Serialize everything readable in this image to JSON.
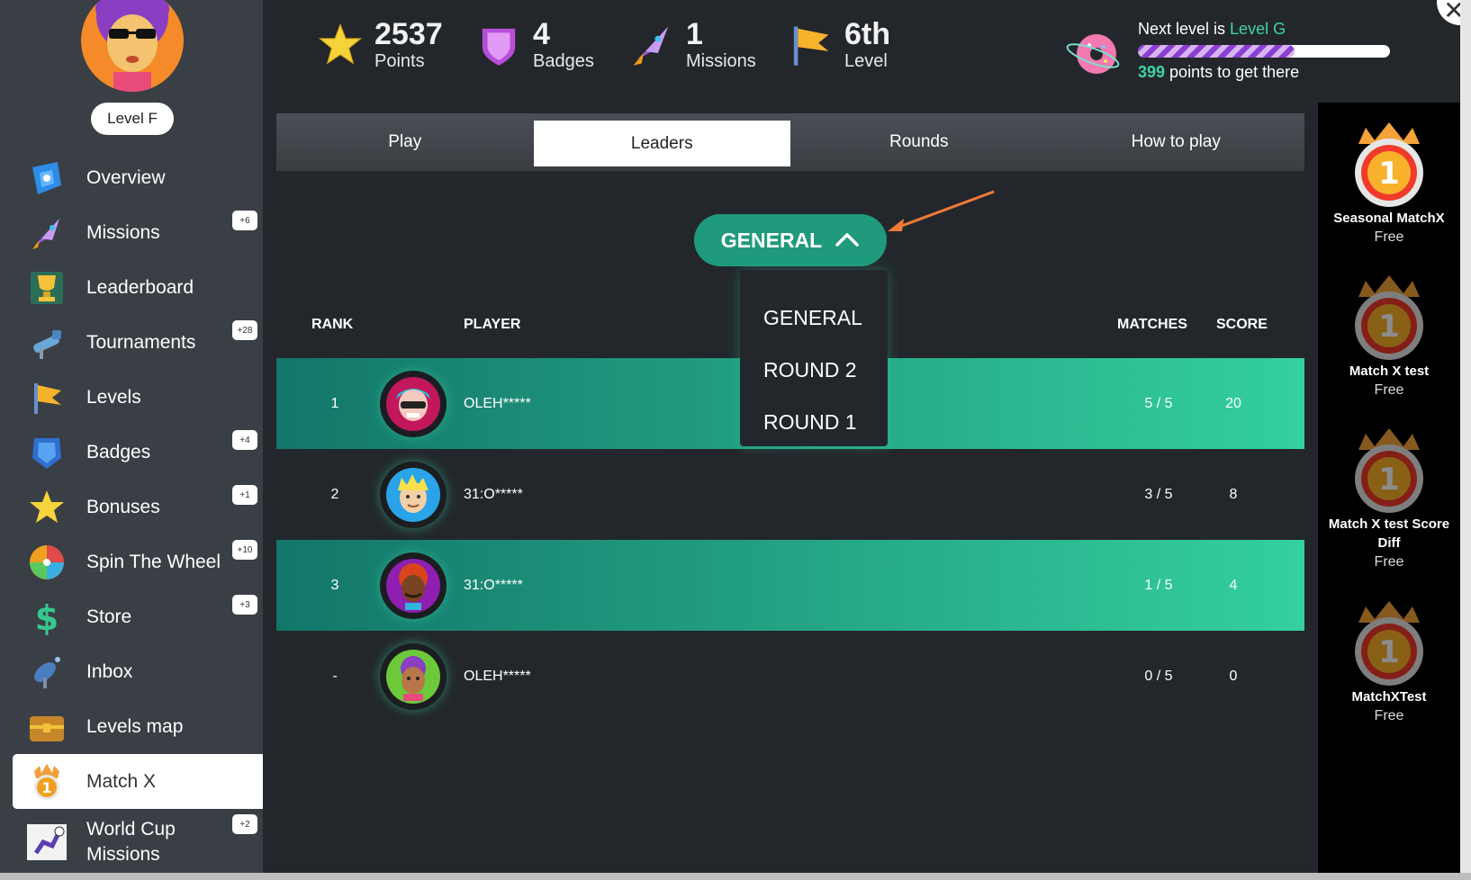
{
  "profile": {
    "level_label": "Level F"
  },
  "sidebar": {
    "items": [
      {
        "label": "Overview",
        "icon": "overview-icon"
      },
      {
        "label": "Missions",
        "icon": "rocket-icon",
        "badge": "+6"
      },
      {
        "label": "Leaderboard",
        "icon": "trophy-icon"
      },
      {
        "label": "Tournaments",
        "icon": "telescope-icon",
        "badge": "+28"
      },
      {
        "label": "Levels",
        "icon": "flag-icon"
      },
      {
        "label": "Badges",
        "icon": "shield-icon",
        "badge": "+4"
      },
      {
        "label": "Bonuses",
        "icon": "star-icon",
        "badge": "+1"
      },
      {
        "label": "Spin The Wheel",
        "icon": "wheel-icon",
        "badge": "+10"
      },
      {
        "label": "Store",
        "icon": "dollar-icon",
        "badge": "+3"
      },
      {
        "label": "Inbox",
        "icon": "satellite-icon"
      },
      {
        "label": "Levels map",
        "icon": "chest-icon"
      },
      {
        "label": "Match X",
        "icon": "medal-icon",
        "active": true
      },
      {
        "label": "World Cup Missions",
        "icon": "soccer-icon",
        "badge": "+2"
      }
    ]
  },
  "stats": {
    "points": {
      "value": "2537",
      "label": "Points"
    },
    "badges": {
      "value": "4",
      "label": "Badges"
    },
    "missions": {
      "value": "1",
      "label": "Missions"
    },
    "level": {
      "value": "6th",
      "label": "Level"
    }
  },
  "next_level": {
    "prefix": "Next level is ",
    "level": "Level G",
    "points": "399",
    "suffix": " points to get there",
    "progress": 0.62
  },
  "tabs": [
    "Play",
    "Leaders",
    "Rounds",
    "How to play"
  ],
  "active_tab": 1,
  "dropdown": {
    "selected": "GENERAL",
    "options": [
      "GENERAL",
      "ROUND 2",
      "ROUND 1"
    ]
  },
  "table": {
    "headers": {
      "rank": "RANK",
      "player": "PLAYER",
      "matches": "MATCHES",
      "score": "SCORE"
    },
    "rows": [
      {
        "rank": "1",
        "player": "OLEH*****",
        "matches": "5 / 5",
        "score": "20",
        "highlight": true
      },
      {
        "rank": "2",
        "player": "31:O*****",
        "matches": "3 / 5",
        "score": "8",
        "highlight": false
      },
      {
        "rank": "3",
        "player": "31:O*****",
        "matches": "1 / 5",
        "score": "4",
        "highlight": true
      },
      {
        "rank": "-",
        "player": "OLEH*****",
        "matches": "0 / 5",
        "score": "0",
        "highlight": false
      }
    ]
  },
  "matchx_list": [
    {
      "name": "Seasonal MatchX",
      "price": "Free",
      "active": true
    },
    {
      "name": "Match X test",
      "price": "Free",
      "active": false
    },
    {
      "name": "Match X test Score Diff",
      "price": "Free",
      "active": false
    },
    {
      "name": "MatchXTest",
      "price": "Free",
      "active": false
    }
  ],
  "colors": {
    "accent": "#1f9a7c",
    "accent_light": "#34d09e",
    "panel": "#23272b",
    "sidebar": "#3a3f45"
  }
}
